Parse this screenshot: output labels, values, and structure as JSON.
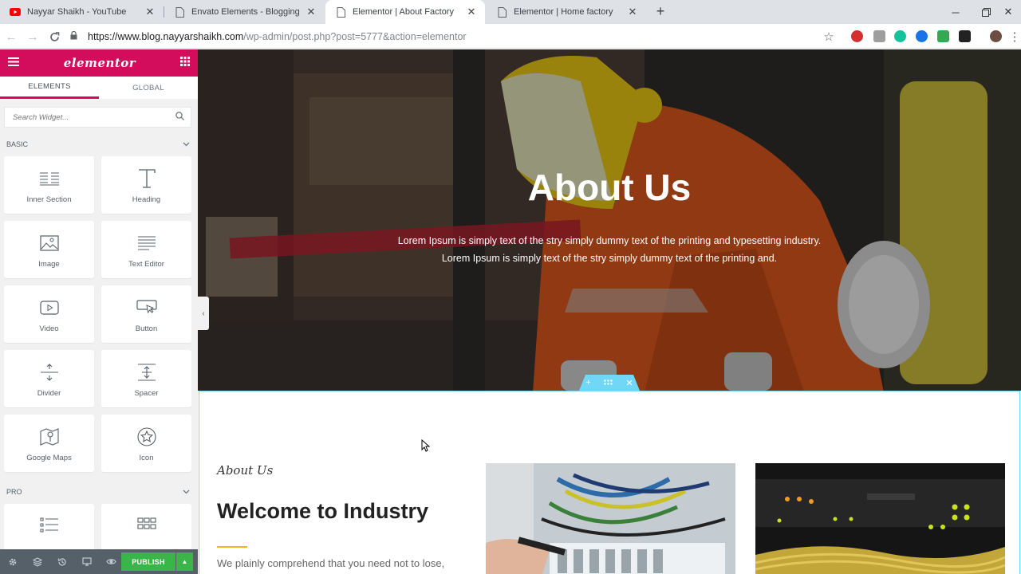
{
  "browser": {
    "tabs": [
      {
        "title": "Nayyar Shaikh - YouTube",
        "icon": "youtube-icon",
        "active": false
      },
      {
        "title": "Envato Elements - Blogging Tuto",
        "icon": "page-icon",
        "active": false
      },
      {
        "title": "Elementor | About Factory",
        "icon": "page-icon",
        "active": true
      },
      {
        "title": "Elementor | Home factory",
        "icon": "page-icon",
        "active": false
      }
    ],
    "url_host": "https://www.blog.nayyarshaikh.com",
    "url_path": "/wp-admin/post.php?post=5777&action=elementor",
    "extensions": [
      "abp-icon",
      "ext-icon",
      "grammarly-icon",
      "ext-blue-icon",
      "drive-icon",
      "ext-dark-icon",
      "profile-icon"
    ]
  },
  "panel": {
    "logo": "elementor",
    "tabs": [
      "ELEMENTS",
      "GLOBAL"
    ],
    "search_placeholder": "Search Widget...",
    "categories": {
      "basic": "BASIC",
      "pro": "PRO"
    },
    "widgets": [
      {
        "label": "Inner Section",
        "icon": "inner-section-icon"
      },
      {
        "label": "Heading",
        "icon": "heading-icon"
      },
      {
        "label": "Image",
        "icon": "image-icon"
      },
      {
        "label": "Text Editor",
        "icon": "text-editor-icon"
      },
      {
        "label": "Video",
        "icon": "video-icon"
      },
      {
        "label": "Button",
        "icon": "button-icon"
      },
      {
        "label": "Divider",
        "icon": "divider-icon"
      },
      {
        "label": "Spacer",
        "icon": "spacer-icon"
      },
      {
        "label": "Google Maps",
        "icon": "google-maps-icon"
      },
      {
        "label": "Icon",
        "icon": "star-icon"
      }
    ],
    "publish_label": "PUBLISH"
  },
  "page": {
    "hero_title": "About Us",
    "hero_line1": "Lorem Ipsum is simply text of the stry simply dummy text of the printing and typesetting industry.",
    "hero_line2": "Lorem Ipsum is simply text of the stry simply dummy text of the printing and.",
    "about_small": "About Us",
    "welcome": "Welcome to Industry",
    "body_copy": "We plainly comprehend that you need not to lose,"
  },
  "colors": {
    "elementor_pink": "#d30c5c",
    "publish_green": "#39b54a",
    "section_outline": "#71d7f7",
    "accent_gold": "#f4b71b"
  }
}
